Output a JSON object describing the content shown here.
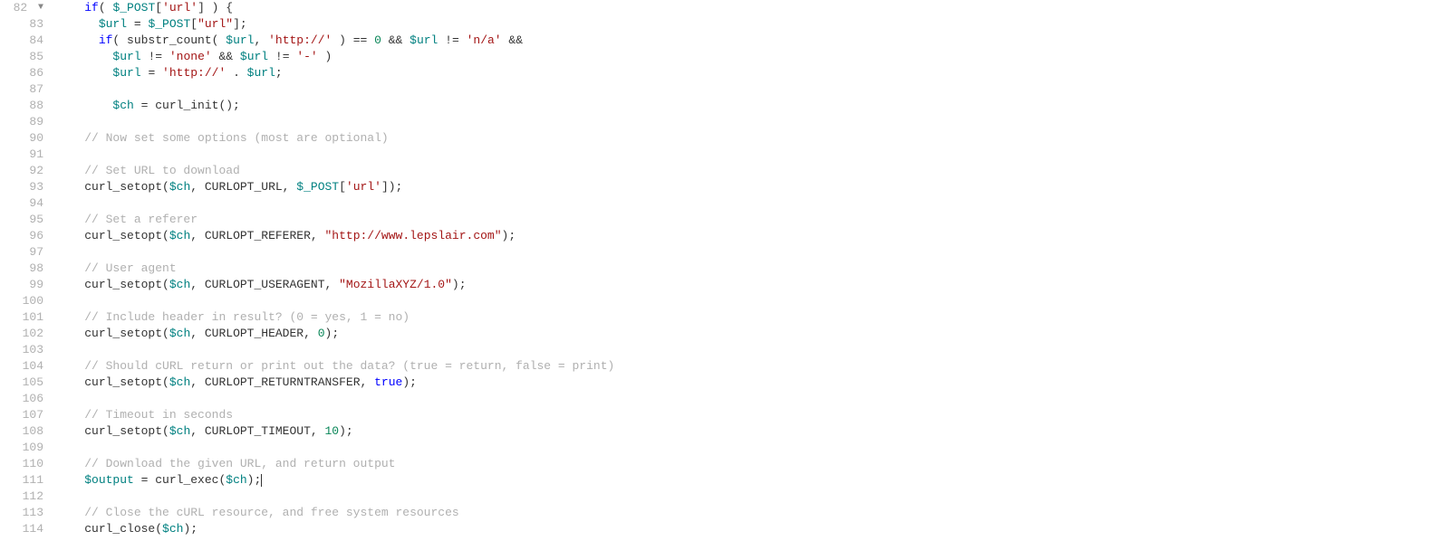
{
  "startLine": 82,
  "foldedLine": 82,
  "lines": [
    {
      "num": 82,
      "indent": "    ",
      "tokens": [
        {
          "t": "if",
          "c": "keyword"
        },
        {
          "t": "( ",
          "c": "punct"
        },
        {
          "t": "$_POST",
          "c": "var"
        },
        {
          "t": "[",
          "c": "punct"
        },
        {
          "t": "'url'",
          "c": "string"
        },
        {
          "t": "] ) {",
          "c": "punct"
        }
      ]
    },
    {
      "num": 83,
      "indent": "      ",
      "tokens": [
        {
          "t": "$url",
          "c": "var"
        },
        {
          "t": " = ",
          "c": "punct"
        },
        {
          "t": "$_POST",
          "c": "var"
        },
        {
          "t": "[",
          "c": "punct"
        },
        {
          "t": "\"url\"",
          "c": "string"
        },
        {
          "t": "];",
          "c": "punct"
        }
      ]
    },
    {
      "num": 84,
      "indent": "      ",
      "tokens": [
        {
          "t": "if",
          "c": "keyword"
        },
        {
          "t": "( ",
          "c": "punct"
        },
        {
          "t": "substr_count",
          "c": "func"
        },
        {
          "t": "( ",
          "c": "punct"
        },
        {
          "t": "$url",
          "c": "var"
        },
        {
          "t": ", ",
          "c": "punct"
        },
        {
          "t": "'http://'",
          "c": "string"
        },
        {
          "t": " ) == ",
          "c": "punct"
        },
        {
          "t": "0",
          "c": "number"
        },
        {
          "t": " && ",
          "c": "punct"
        },
        {
          "t": "$url",
          "c": "var"
        },
        {
          "t": " != ",
          "c": "punct"
        },
        {
          "t": "'n/a'",
          "c": "string"
        },
        {
          "t": " &&",
          "c": "punct"
        }
      ]
    },
    {
      "num": 85,
      "indent": "        ",
      "tokens": [
        {
          "t": "$url",
          "c": "var"
        },
        {
          "t": " != ",
          "c": "punct"
        },
        {
          "t": "'none'",
          "c": "string"
        },
        {
          "t": " && ",
          "c": "punct"
        },
        {
          "t": "$url",
          "c": "var"
        },
        {
          "t": " != ",
          "c": "punct"
        },
        {
          "t": "'-'",
          "c": "string"
        },
        {
          "t": " )",
          "c": "punct"
        }
      ]
    },
    {
      "num": 86,
      "indent": "        ",
      "tokens": [
        {
          "t": "$url",
          "c": "var"
        },
        {
          "t": " = ",
          "c": "punct"
        },
        {
          "t": "'http://'",
          "c": "string"
        },
        {
          "t": " . ",
          "c": "punct"
        },
        {
          "t": "$url",
          "c": "var"
        },
        {
          "t": ";",
          "c": "punct"
        }
      ]
    },
    {
      "num": 87,
      "indent": "",
      "tokens": []
    },
    {
      "num": 88,
      "indent": "        ",
      "tokens": [
        {
          "t": "$ch",
          "c": "var"
        },
        {
          "t": " = ",
          "c": "punct"
        },
        {
          "t": "curl_init",
          "c": "func"
        },
        {
          "t": "();",
          "c": "punct"
        }
      ]
    },
    {
      "num": 89,
      "indent": "",
      "tokens": []
    },
    {
      "num": 90,
      "indent": "    ",
      "tokens": [
        {
          "t": "// Now set some options (most are optional)",
          "c": "comment"
        }
      ]
    },
    {
      "num": 91,
      "indent": "",
      "tokens": []
    },
    {
      "num": 92,
      "indent": "    ",
      "tokens": [
        {
          "t": "// Set URL to download",
          "c": "comment"
        }
      ]
    },
    {
      "num": 93,
      "indent": "    ",
      "tokens": [
        {
          "t": "curl_setopt",
          "c": "func"
        },
        {
          "t": "(",
          "c": "punct"
        },
        {
          "t": "$ch",
          "c": "var"
        },
        {
          "t": ", CURLOPT_URL, ",
          "c": "punct"
        },
        {
          "t": "$_POST",
          "c": "var"
        },
        {
          "t": "[",
          "c": "punct"
        },
        {
          "t": "'url'",
          "c": "string"
        },
        {
          "t": "]);",
          "c": "punct"
        }
      ]
    },
    {
      "num": 94,
      "indent": "",
      "tokens": []
    },
    {
      "num": 95,
      "indent": "    ",
      "tokens": [
        {
          "t": "// Set a referer",
          "c": "comment"
        }
      ]
    },
    {
      "num": 96,
      "indent": "    ",
      "tokens": [
        {
          "t": "curl_setopt",
          "c": "func"
        },
        {
          "t": "(",
          "c": "punct"
        },
        {
          "t": "$ch",
          "c": "var"
        },
        {
          "t": ", CURLOPT_REFERER, ",
          "c": "punct"
        },
        {
          "t": "\"http://www.lepslair.com\"",
          "c": "string"
        },
        {
          "t": ");",
          "c": "punct"
        }
      ]
    },
    {
      "num": 97,
      "indent": "",
      "tokens": []
    },
    {
      "num": 98,
      "indent": "    ",
      "tokens": [
        {
          "t": "// User agent",
          "c": "comment"
        }
      ]
    },
    {
      "num": 99,
      "indent": "    ",
      "tokens": [
        {
          "t": "curl_setopt",
          "c": "func"
        },
        {
          "t": "(",
          "c": "punct"
        },
        {
          "t": "$ch",
          "c": "var"
        },
        {
          "t": ", CURLOPT_USERAGENT, ",
          "c": "punct"
        },
        {
          "t": "\"MozillaXYZ/1.0\"",
          "c": "string"
        },
        {
          "t": ");",
          "c": "punct"
        }
      ]
    },
    {
      "num": 100,
      "indent": "",
      "tokens": []
    },
    {
      "num": 101,
      "indent": "    ",
      "tokens": [
        {
          "t": "// Include header in result? (0 = yes, 1 = no)",
          "c": "comment"
        }
      ]
    },
    {
      "num": 102,
      "indent": "    ",
      "tokens": [
        {
          "t": "curl_setopt",
          "c": "func"
        },
        {
          "t": "(",
          "c": "punct"
        },
        {
          "t": "$ch",
          "c": "var"
        },
        {
          "t": ", CURLOPT_HEADER, ",
          "c": "punct"
        },
        {
          "t": "0",
          "c": "number"
        },
        {
          "t": ");",
          "c": "punct"
        }
      ]
    },
    {
      "num": 103,
      "indent": "",
      "tokens": []
    },
    {
      "num": 104,
      "indent": "    ",
      "tokens": [
        {
          "t": "// Should cURL return or print out the data? (true = return, false = print)",
          "c": "comment"
        }
      ]
    },
    {
      "num": 105,
      "indent": "    ",
      "tokens": [
        {
          "t": "curl_setopt",
          "c": "func"
        },
        {
          "t": "(",
          "c": "punct"
        },
        {
          "t": "$ch",
          "c": "var"
        },
        {
          "t": ", CURLOPT_RETURNTRANSFER, ",
          "c": "punct"
        },
        {
          "t": "true",
          "c": "keyword"
        },
        {
          "t": ");",
          "c": "punct"
        }
      ]
    },
    {
      "num": 106,
      "indent": "",
      "tokens": []
    },
    {
      "num": 107,
      "indent": "    ",
      "tokens": [
        {
          "t": "// Timeout in seconds",
          "c": "comment"
        }
      ]
    },
    {
      "num": 108,
      "indent": "    ",
      "tokens": [
        {
          "t": "curl_setopt",
          "c": "func"
        },
        {
          "t": "(",
          "c": "punct"
        },
        {
          "t": "$ch",
          "c": "var"
        },
        {
          "t": ", CURLOPT_TIMEOUT, ",
          "c": "punct"
        },
        {
          "t": "10",
          "c": "number"
        },
        {
          "t": ");",
          "c": "punct"
        }
      ]
    },
    {
      "num": 109,
      "indent": "",
      "tokens": []
    },
    {
      "num": 110,
      "indent": "    ",
      "tokens": [
        {
          "t": "// Download the given URL, and return output",
          "c": "comment"
        }
      ]
    },
    {
      "num": 111,
      "indent": "    ",
      "tokens": [
        {
          "t": "$output",
          "c": "var"
        },
        {
          "t": " = ",
          "c": "punct"
        },
        {
          "t": "curl_exec",
          "c": "func"
        },
        {
          "t": "(",
          "c": "punct"
        },
        {
          "t": "$ch",
          "c": "var"
        },
        {
          "t": ");",
          "c": "punct"
        }
      ],
      "cursor": true
    },
    {
      "num": 112,
      "indent": "",
      "tokens": []
    },
    {
      "num": 113,
      "indent": "    ",
      "tokens": [
        {
          "t": "// Close the cURL resource, and free system resources",
          "c": "comment"
        }
      ]
    },
    {
      "num": 114,
      "indent": "    ",
      "tokens": [
        {
          "t": "curl_close",
          "c": "func"
        },
        {
          "t": "(",
          "c": "punct"
        },
        {
          "t": "$ch",
          "c": "var"
        },
        {
          "t": ");",
          "c": "punct"
        }
      ]
    }
  ]
}
